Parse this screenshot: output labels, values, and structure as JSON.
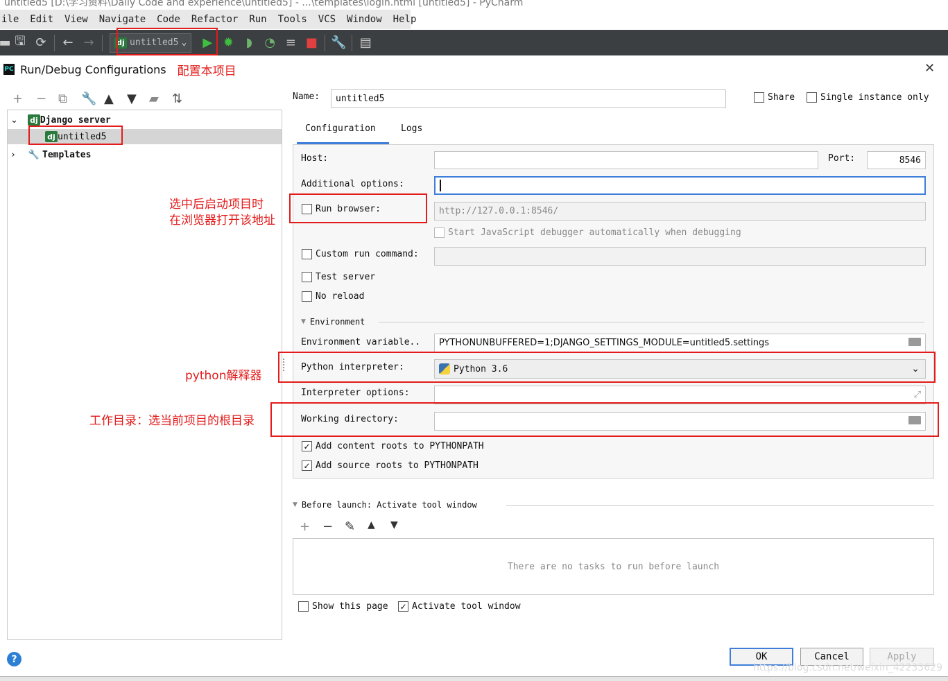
{
  "window": {
    "title": "untitled5 [D:\\学习资料\\Daily Code and experience\\untitled5] - ...\\templates\\login.html [untitled5] - PyCharm"
  },
  "menu": [
    "ile",
    "Edit",
    "View",
    "Navigate",
    "Code",
    "Refactor",
    "Run",
    "Tools",
    "VCS",
    "Window",
    "Help"
  ],
  "toolbar": {
    "run_config": "untitled5"
  },
  "dialog": {
    "title": "Run/Debug Configurations",
    "close_glyph": "✕"
  },
  "annotations": {
    "config_project": "配置本项目",
    "browser_note_line1": "选中后启动项目时",
    "browser_note_line2": "在浏览器打开该地址",
    "interpreter_note": "python解释器",
    "workdir_note": "工作目录：选当前项目的根目录"
  },
  "tree": {
    "group": "Django server",
    "item": "untitled5",
    "templates": "Templates"
  },
  "form": {
    "name_label": "Name:",
    "name_value": "untitled5",
    "share_label": "Share",
    "single_instance_label": "Single instance only",
    "tabs": [
      "Configuration",
      "Logs"
    ],
    "host_label": "Host:",
    "host_value": "",
    "port_label": "Port:",
    "port_value": "8546",
    "additional_label": "Additional options:",
    "additional_value": "",
    "run_browser_label": "Run browser:",
    "run_browser_url": "http://127.0.0.1:8546/",
    "js_debugger_label": "Start JavaScript debugger automatically when debugging",
    "custom_run_label": "Custom run command:",
    "test_server_label": "Test server",
    "no_reload_label": "No reload",
    "environment_section": "Environment",
    "env_vars_label": "Environment variable..",
    "env_vars_value": "PYTHONUNBUFFERED=1;DJANGO_SETTINGS_MODULE=untitled5.settings",
    "interpreter_label": "Python interpreter:",
    "interpreter_value": "Python 3.6",
    "interp_options_label": "Interpreter options:",
    "workdir_label": "Working directory:",
    "workdir_value": "",
    "content_roots_label": "Add content roots to PYTHONPATH",
    "source_roots_label": "Add source roots to PYTHONPATH",
    "before_launch": "Before launch: Activate tool window",
    "no_tasks": "There are no tasks to run before launch",
    "show_page_label": "Show this page",
    "activate_tool_label": "Activate tool window"
  },
  "buttons": {
    "ok": "OK",
    "cancel": "Cancel",
    "apply": "Apply",
    "help": "?"
  },
  "watermark": "https://blog.csdn.net/weixin_42233629",
  "colors": {
    "accent_red": "#e31b1b",
    "toolbar_bg": "#3c3f41",
    "django_green": "#2b7a3d",
    "focus_blue": "#3d7edb"
  }
}
